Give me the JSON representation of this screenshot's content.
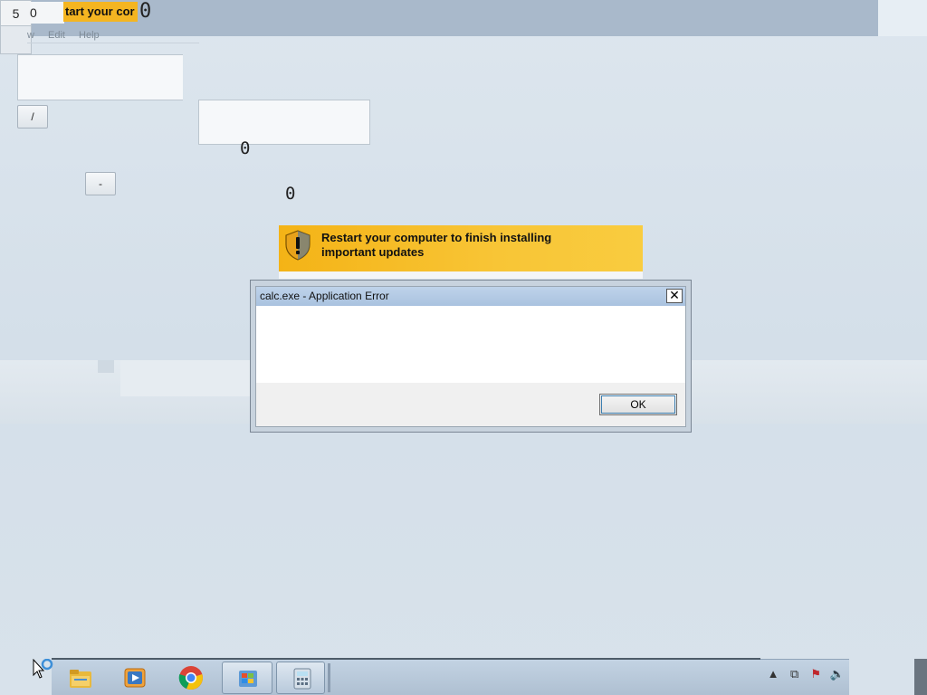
{
  "top": {
    "num_left": "5",
    "num_right": "0",
    "yellow_text": "tart your cor",
    "zero": "0"
  },
  "menu": {
    "items": [
      "w",
      "Edit",
      "Help"
    ]
  },
  "calculator": {
    "divide_label": "/",
    "minus_label": "-",
    "zero_a": "0",
    "zero_b": "0"
  },
  "update": {
    "line1": "Restart your computer to finish installing",
    "line2": "important updates",
    "accent": "#f4b316"
  },
  "dialog": {
    "title": "calc.exe - Application Error",
    "close_glyph": "✕",
    "ok_label": "OK"
  },
  "taskbar": {
    "items": [
      "file-explorer-icon",
      "media-player-icon",
      "chrome-icon",
      "windows-update-icon",
      "calculator-icon"
    ],
    "tray_icons": [
      "show-hidden-icons",
      "network-icon",
      "action-center-icon",
      "volume-icon"
    ]
  }
}
